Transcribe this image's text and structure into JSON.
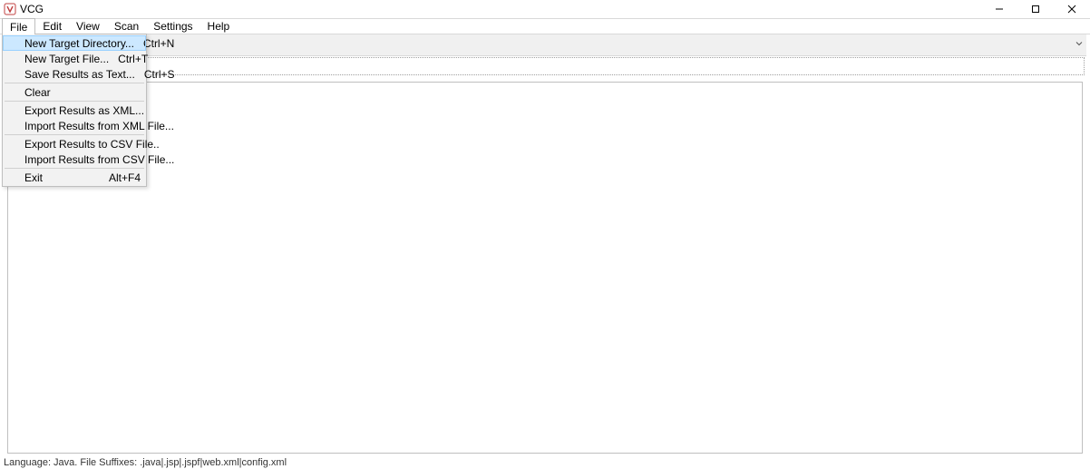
{
  "title": "VCG",
  "menubar": {
    "file": "File",
    "edit": "Edit",
    "view": "View",
    "scan": "Scan",
    "settings": "Settings",
    "help": "Help"
  },
  "file_menu": {
    "new_target_directory": {
      "label": "New Target Directory...",
      "shortcut": "Ctrl+N"
    },
    "new_target_file": {
      "label": "New Target File...",
      "shortcut": "Ctrl+T"
    },
    "save_results_as_text": {
      "label": "Save Results as Text...",
      "shortcut": "Ctrl+S"
    },
    "clear": {
      "label": "Clear",
      "shortcut": ""
    },
    "export_results_as_xml": {
      "label": "Export Results as XML...",
      "shortcut": ""
    },
    "import_results_from_xml": {
      "label": "Import Results from XML File...",
      "shortcut": ""
    },
    "export_results_to_csv": {
      "label": "Export Results to CSV File..",
      "shortcut": ""
    },
    "import_results_from_csv": {
      "label": "Import Results from CSV File...",
      "shortcut": ""
    },
    "exit": {
      "label": "Exit",
      "shortcut": "Alt+F4"
    }
  },
  "statusbar": "Language: Java.  File Suffixes: .java|.jsp|.jspf|web.xml|config.xml"
}
